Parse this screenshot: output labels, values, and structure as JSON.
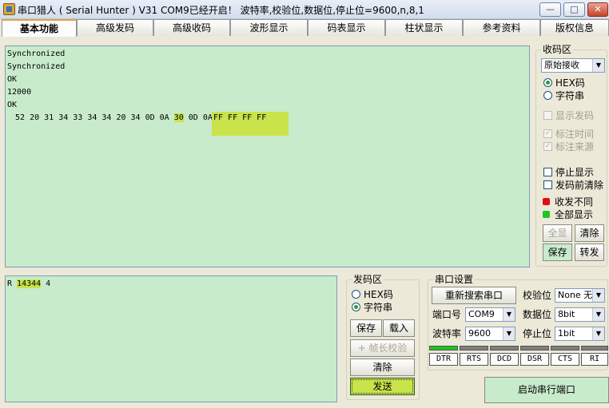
{
  "window": {
    "title": "串口猎人 ( Serial Hunter ) V31    COM9已经开启！ 波特率,校验位,数据位,停止位=9600,n,8,1",
    "controls": [
      "—",
      "□",
      "✕"
    ]
  },
  "tabs": [
    "基本功能",
    "高级发码",
    "高级收码",
    "波形显示",
    "码表显示",
    "柱状显示",
    "参考资料",
    "版权信息"
  ],
  "receive": {
    "lines": [
      "Synchronized",
      "Synchronized",
      "OK",
      "12000",
      "OK"
    ],
    "hex_prefix": " 52 20 31 34 33 34 34 20 34 0D 0A ",
    "hex_highlight": "30",
    "hex_middle": " 0D 0A ",
    "hex_tail": "FF FF FF FF"
  },
  "recv_panel": {
    "title": "收码区",
    "mode_select": "原始接收",
    "radio_hex": "HEX码",
    "radio_str": "字符串",
    "show_send": "显示发码",
    "mark_time": "标注时间",
    "mark_source": "标注来源",
    "stop_display": "停止显示",
    "clear_before_send": "发码前清除",
    "legend_diff": "收发不同",
    "legend_all": "全部显示",
    "btn_select_all": "全显",
    "btn_clear": "清除",
    "btn_save": "保存",
    "btn_forward": "转发",
    "colors": {
      "diff": "#e01010",
      "all": "#21c421"
    }
  },
  "send": {
    "prefix": "R ",
    "highlight": "14344",
    "suffix": " 4"
  },
  "send_panel": {
    "title": "发码区",
    "radio_hex": "HEX码",
    "radio_str": "字符串",
    "btn_save": "保存",
    "btn_load": "载入",
    "btn_frame_check": "+ 帧长校验",
    "btn_clear": "清除",
    "btn_send": "发送"
  },
  "port": {
    "title": "串口设置",
    "btn_rescan": "重新搜索串口",
    "parity_label": "校验位",
    "parity_value": "None 无",
    "port_label": "端口号",
    "port_value": "COM9",
    "databits_label": "数据位",
    "databits_value": "8bit",
    "baud_label": "波特率",
    "baud_value": "9600",
    "stopbits_label": "停止位",
    "stopbits_value": "1bit",
    "modem": [
      "DTR",
      "RTS",
      "DCD",
      "DSR",
      "CTS",
      "RI"
    ],
    "btn_open": "启动串行端口"
  }
}
